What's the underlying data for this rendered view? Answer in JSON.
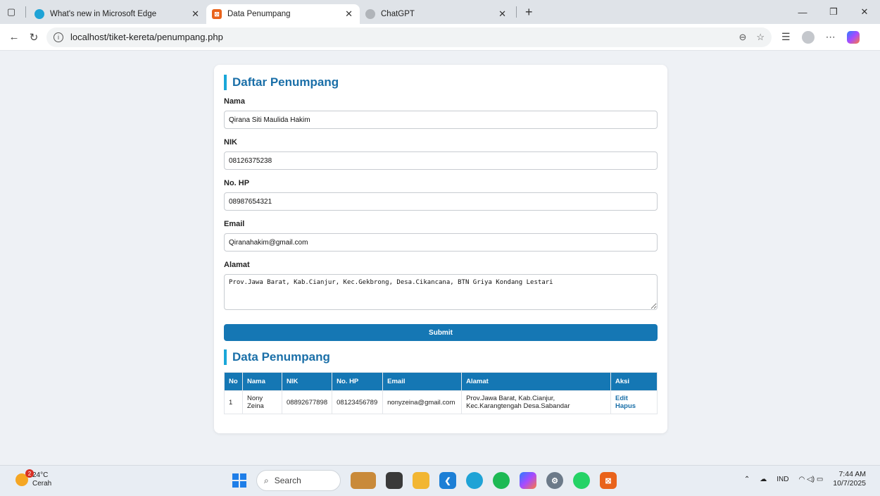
{
  "browser": {
    "tabs": [
      {
        "label": "What's new in Microsoft Edge",
        "color": "#1fa3d6"
      },
      {
        "label": "Data Penumpang",
        "color": "#e9631b"
      },
      {
        "label": "ChatGPT",
        "color": "#9aa0a6"
      }
    ],
    "url": "localhost/tiket-kereta/penumpang.php"
  },
  "form": {
    "title": "Daftar Penumpang",
    "nama_label": "Nama",
    "nama_value": "Qirana Siti Maulida Hakim",
    "nik_label": "NIK",
    "nik_value": "08126375238",
    "hp_label": "No. HP",
    "hp_value": "08987654321",
    "email_label": "Email",
    "email_value": "Qiranahakim@gmail.com",
    "alamat_label": "Alamat",
    "alamat_value": "Prov.Jawa Barat, Kab.Cianjur, Kec.Gekbrong, Desa.Cikancana, BTN Griya Kondang Lestari",
    "submit_label": "Submit"
  },
  "table": {
    "title": "Data Penumpang",
    "headers": [
      "No",
      "Nama",
      "NIK",
      "No. HP",
      "Email",
      "Alamat",
      "Aksi"
    ],
    "rows": [
      {
        "no": "1",
        "nama": "Nony Zeina",
        "nik": "08892677898",
        "hp": "08123456789",
        "email": "nonyzeina@gmail.com",
        "alamat": "Prov.Jawa Barat, Kab.Cianjur, Kec.Karangtengah Desa.Sabandar",
        "edit": "Edit",
        "hapus": "Hapus"
      }
    ]
  },
  "taskbar": {
    "temp": "24°C",
    "weather": "Cerah",
    "weather_badge": "2",
    "search": "Search",
    "lang": "IND",
    "time": "7:44 AM",
    "date": "10/7/2025"
  }
}
